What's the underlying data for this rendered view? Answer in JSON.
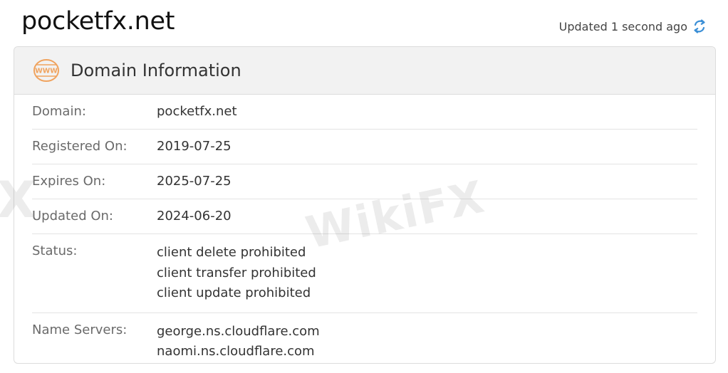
{
  "site": {
    "title": "pocketfx.net",
    "updated_text": "Updated 1 second ago"
  },
  "card": {
    "title": "Domain Information",
    "icon_text": "WWW"
  },
  "rows": [
    {
      "label": "Domain:",
      "values": [
        "pocketfx.net"
      ]
    },
    {
      "label": "Registered On:",
      "values": [
        "2019-07-25"
      ]
    },
    {
      "label": "Expires On:",
      "values": [
        "2025-07-25"
      ]
    },
    {
      "label": "Updated On:",
      "values": [
        "2024-06-20"
      ]
    },
    {
      "label": "Status:",
      "values": [
        "client delete prohibited",
        "client transfer prohibited",
        "client update prohibited"
      ]
    },
    {
      "label": "Name Servers:",
      "values": [
        "george.ns.cloudflare.com",
        "naomi.ns.cloudflare.com"
      ]
    }
  ],
  "watermark": {
    "brand": "WikiFX",
    "partial": "X"
  },
  "colors": {
    "accent": "#f0a35e",
    "refresh": "#3b8fd6"
  }
}
